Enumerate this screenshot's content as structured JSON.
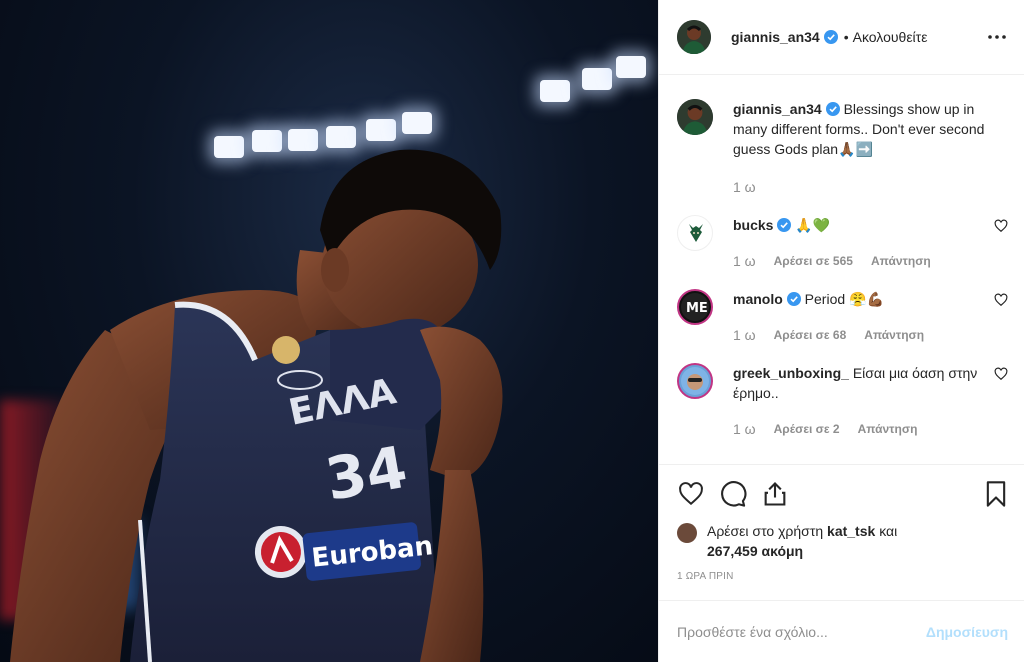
{
  "post": {
    "author": "giannis_an34",
    "follow_dot": "•",
    "follow_status": "Ακολουθείτε",
    "caption": "Blessings show up in many different forms.. Don't ever second guess Gods plan🙏🏾➡️",
    "caption_time": "1 ω",
    "jersey_number": "34",
    "jersey_text": "ΕΛΛΑ",
    "sponsor": "Euroban"
  },
  "comments": [
    {
      "user": "bucks",
      "verified": true,
      "text": "🙏💚",
      "time": "1 ω",
      "likes": "Αρέσει σε 565",
      "reply": "Απάντηση"
    },
    {
      "user": "manolo",
      "verified": true,
      "text": "Period 😤💪🏾",
      "time": "1 ω",
      "likes": "Αρέσει σε 68",
      "reply": "Απάντηση"
    },
    {
      "user": "greek_unboxing_",
      "verified": false,
      "text": "Είσαι μια όαση στην έρημο..",
      "time": "1 ω",
      "likes": "Αρέσει σε 2",
      "reply": "Απάντηση"
    }
  ],
  "likes": {
    "prefix": "Αρέσει στο χρήστη",
    "user": "kat_tsk",
    "and": "και",
    "count": "267,459 ακόμη"
  },
  "posted_time": "1 ΩΡΑ ΠΡΙΝ",
  "add_comment": {
    "placeholder": "Προσθέστε ένα σχόλιο...",
    "publish": "Δημοσίευση"
  },
  "icons": [
    "more-icon",
    "verified-icon",
    "heart-icon",
    "comment-icon",
    "share-icon",
    "bookmark-icon"
  ],
  "colors": {
    "verified": "#3897f0",
    "publish_disabled": "#b2dffc",
    "muted": "#8e8e8e",
    "text": "#262626"
  }
}
